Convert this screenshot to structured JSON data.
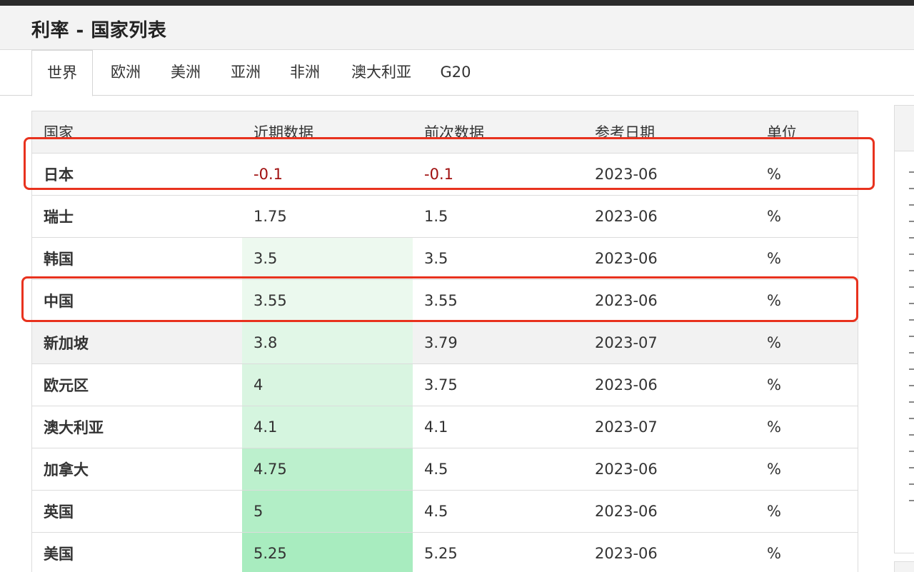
{
  "page": {
    "title": "利率 - 国家列表"
  },
  "tabs": [
    {
      "label": "世界",
      "active": true
    },
    {
      "label": "欧洲",
      "active": false
    },
    {
      "label": "美洲",
      "active": false
    },
    {
      "label": "亚洲",
      "active": false
    },
    {
      "label": "非洲",
      "active": false
    },
    {
      "label": "澳大利亚",
      "active": false
    },
    {
      "label": "G20",
      "active": false
    }
  ],
  "table": {
    "headers": [
      "国家",
      "近期数据",
      "前次数据",
      "参考日期",
      "单位"
    ],
    "rows": [
      {
        "country": "日本",
        "latest": "-0.1",
        "previous": "-0.1",
        "date": "2023-06",
        "unit": "%"
      },
      {
        "country": "瑞士",
        "latest": "1.75",
        "previous": "1.5",
        "date": "2023-06",
        "unit": "%"
      },
      {
        "country": "韩国",
        "latest": "3.5",
        "previous": "3.5",
        "date": "2023-06",
        "unit": "%"
      },
      {
        "country": "中国",
        "latest": "3.55",
        "previous": "3.55",
        "date": "2023-06",
        "unit": "%"
      },
      {
        "country": "新加坡",
        "latest": "3.8",
        "previous": "3.79",
        "date": "2023-07",
        "unit": "%"
      },
      {
        "country": "欧元区",
        "latest": "4",
        "previous": "3.75",
        "date": "2023-06",
        "unit": "%"
      },
      {
        "country": "澳大利亚",
        "latest": "4.1",
        "previous": "4.1",
        "date": "2023-07",
        "unit": "%"
      },
      {
        "country": "加拿大",
        "latest": "4.75",
        "previous": "4.5",
        "date": "2023-06",
        "unit": "%"
      },
      {
        "country": "英国",
        "latest": "5",
        "previous": "4.5",
        "date": "2023-06",
        "unit": "%"
      },
      {
        "country": "美国",
        "latest": "5.25",
        "previous": "5.25",
        "date": "2023-06",
        "unit": "%"
      }
    ]
  },
  "colors": {
    "highlight_border": "#e8321e",
    "negative_value": "#a01010",
    "heat_low": "#edf9ef",
    "heat_high": "#a8ecbf"
  },
  "annotations": {
    "highlighted_countries": [
      "日本",
      "中国"
    ]
  }
}
